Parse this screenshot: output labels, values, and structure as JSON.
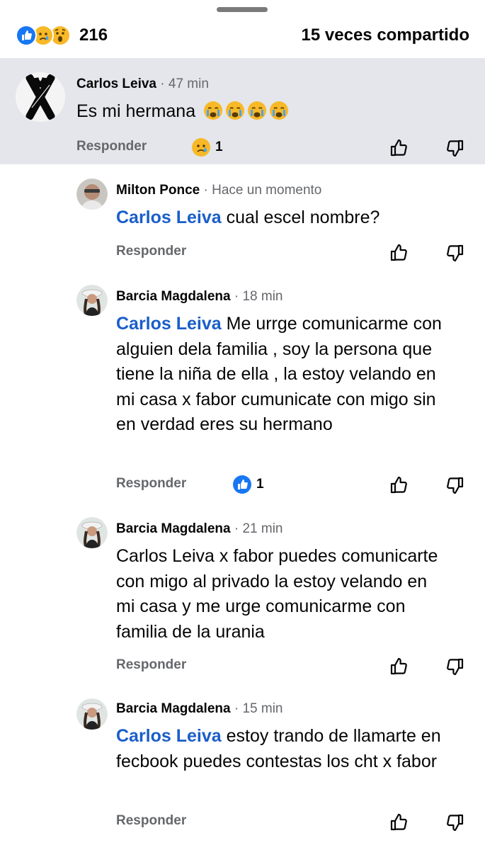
{
  "summary": {
    "reaction_icons": [
      "like-icon",
      "sad-face-icon",
      "wow-face-icon"
    ],
    "reaction_count": "216",
    "share_text": "15 veces compartido"
  },
  "comments": [
    {
      "author": "Carlos Leiva",
      "time": "47 min",
      "text": "Es mi hermana",
      "emoji_icons": [
        "crying-face-icon",
        "crying-face-icon",
        "crying-face-icon",
        "crying-face-icon"
      ],
      "reply_label": "Responder",
      "reaction_icon": "sad-face-icon",
      "reaction_count": "1",
      "highlighted": true
    },
    {
      "author": "Milton Ponce",
      "time": "Hace un momento",
      "mention": "Carlos Leiva",
      "text": "cual escel nombre?",
      "reply_label": "Responder"
    },
    {
      "author": "Barcia Magdalena",
      "time": "18 min",
      "mention": "Carlos Leiva",
      "text": "Me urrge comunicarme con alguien dela familia , soy la persona que tiene la niña de ella , la estoy velando en mi casa x fabor cumunicate con migo sin en verdad eres su hermano",
      "reply_label": "Responder",
      "reaction_icon": "like-icon",
      "reaction_count": "1"
    },
    {
      "author": "Barcia Magdalena",
      "time": "21 min",
      "text": "Carlos Leiva x fabor puedes comunicarte con migo al privado la estoy velando en mi casa y me urge comunicarme con familia de la urania",
      "reply_label": "Responder"
    },
    {
      "author": "Barcia Magdalena",
      "time": "15 min",
      "mention": "Carlos Leiva",
      "text": "estoy trando de llamarte en fecbook puedes contestas los cht x fabor",
      "reply_label": "Responder"
    }
  ],
  "colors": {
    "mention": "#1a5ec9",
    "highlight_bg": "#e4e6eb",
    "like_blue": "#1877f2",
    "emoji_yellow": "#f7b928",
    "secondary_text": "#65676b"
  }
}
